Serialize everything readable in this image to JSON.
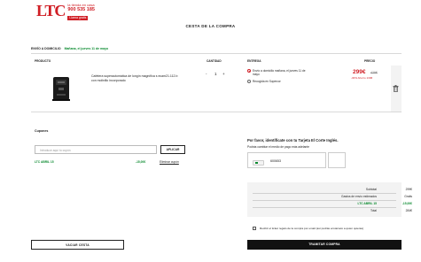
{
  "header": {
    "logo_mark": "LTC",
    "logo_tagline": "la tienda en casa",
    "phone": "900 535 185",
    "badge": "Llama gratis"
  },
  "page_title": "CESTA DE LA COMPRA",
  "delivery": {
    "label": "ENVÍO A DOMICILIO",
    "date": "Mañana, el jueves 11 de mayo"
  },
  "columns": {
    "product": "PRODUCTO",
    "quantity": "CANTIDAD",
    "delivery": "ENTREGA",
    "price": "PRECIO"
  },
  "product": {
    "name": "Cafetera superautomática de longín magnífica s ecam21.112.b con molinillo incorporado",
    "quantity": "1",
    "minus": "-",
    "plus": "+",
    "delivery_options": [
      {
        "label": "Envío a domicilio mañana, el jueves 11 de mayo",
        "selected": true
      },
      {
        "label": "Recogida en Supercor",
        "selected": false
      }
    ],
    "price": "299€",
    "old_price": "429€",
    "discount": "-30%   Ahorro 130€"
  },
  "coupons": {
    "title": "Cupones",
    "placeholder": "Introduce aquí tu cupón",
    "apply_label": "APLICAR",
    "applied_code": "LTC ABRIL 15",
    "applied_amount": "-15,00€",
    "remove_label": "Eliminar cupón"
  },
  "identify": {
    "title": "Por favor, identifícate con tu Tarjeta El Corte Inglés.",
    "subtitle": "Podrás cambiar el medio de pago más adelante",
    "card_number": "600653"
  },
  "summary": {
    "rows": [
      {
        "label": "Subtotal",
        "value": "299€"
      },
      {
        "label": "Gastos de envío estimados",
        "value": "Gratis"
      },
      {
        "label": "LTC ABRIL 15",
        "value": "-15,00€"
      },
      {
        "label": "Total",
        "value": "284€"
      }
    ]
  },
  "receipt_text": "Recibir el ticket regalo de la compra por email (así podrás enviarselo a quien quieras)",
  "buttons": {
    "checkout": "TRAMITAR COMPRA",
    "empty_cart": "VACIAR CESTA"
  },
  "colors": {
    "brand_red": "#d01e25",
    "green": "#0a8a2f",
    "dark": "#111111"
  }
}
